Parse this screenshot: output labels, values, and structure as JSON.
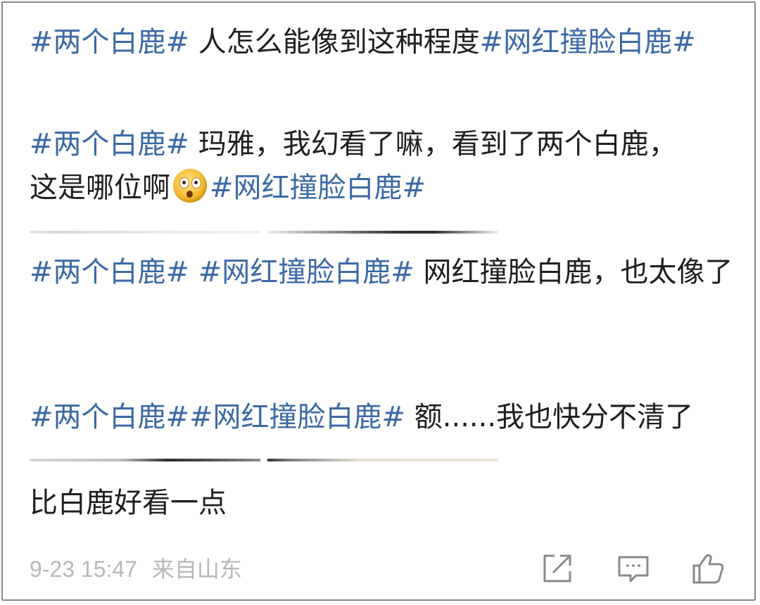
{
  "posts": [
    {
      "parts": [
        {
          "text": "#两个白鹿#",
          "kind": "tag"
        },
        {
          "text": " 人怎么能像到这种程度",
          "kind": "text"
        },
        {
          "text": "#网红撞脸白鹿#",
          "kind": "tag"
        }
      ]
    },
    {
      "parts": [
        {
          "text": "#两个白鹿#",
          "kind": "tag"
        },
        {
          "text": " 玛雅，我幻看了嘛，看到了两个白鹿，这是哪位啊",
          "kind": "text"
        },
        {
          "text": "#网红撞脸白鹿#",
          "kind": "tag"
        }
      ],
      "emoji": "astonished-emoji"
    },
    {
      "parts": [
        {
          "text": "#两个白鹿#",
          "kind": "tag"
        },
        {
          "text": " ",
          "kind": "text"
        },
        {
          "text": "#网红撞脸白鹿#",
          "kind": "tag"
        },
        {
          "text": " 网红撞脸白鹿，也太像了",
          "kind": "text"
        }
      ]
    },
    {
      "parts": [
        {
          "text": "#两个白鹿#",
          "kind": "tag"
        },
        {
          "text": "#网红撞脸白鹿#",
          "kind": "tag"
        },
        {
          "text": " 额......我也快分不清了",
          "kind": "text"
        }
      ]
    },
    {
      "parts": [
        {
          "text": "比白鹿好看一点",
          "kind": "text"
        }
      ]
    }
  ],
  "meta": {
    "date": "9-23 15:47",
    "source": "来自山东"
  },
  "actions": [
    {
      "name": "share-icon"
    },
    {
      "name": "comment-icon"
    },
    {
      "name": "like-icon"
    }
  ],
  "colors": {
    "tag": "#3b6aa5",
    "text": "#1f1f1f",
    "meta": "#b8b8b8",
    "border": "#8a8a8a"
  }
}
